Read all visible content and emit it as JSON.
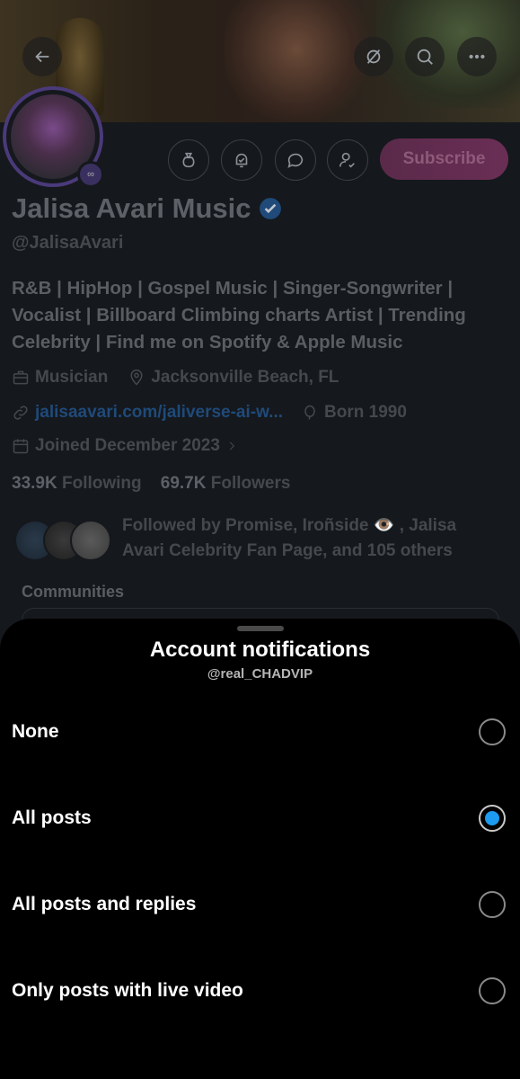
{
  "profile": {
    "name": "Jalisa Avari Music",
    "handle": "@JalisaAvari",
    "bio": "R&B | HipHop | Gospel Music | Singer-Songwriter | Vocalist | Billboard Climbing charts Artist | Trending Celebrity | Find me on Spotify & Apple Music",
    "category": "Musician",
    "location": "Jacksonville Beach, FL",
    "website": "jalisaavari.com/jaliverse-ai-w...",
    "born": "Born 1990",
    "joined": "Joined December 2023",
    "following_count": "33.9K",
    "following_label": "Following",
    "followers_count": "69.7K",
    "followers_label": "Followers",
    "followed_by": "Followed by Promise, Irоñside 👁️ , Jalisa Avari Celebrity Fan Page, and 105 others",
    "subscribe_label": "Subscribe",
    "communities_label": "Communities",
    "avatar_badge": "∞"
  },
  "sheet": {
    "title": "Account notifications",
    "subtitle": "@real_CHADVIP",
    "options": [
      {
        "label": "None",
        "selected": false
      },
      {
        "label": "All posts",
        "selected": true
      },
      {
        "label": "All posts and replies",
        "selected": false
      },
      {
        "label": "Only posts with live video",
        "selected": false
      }
    ]
  },
  "colors": {
    "accent": "#1d9bf0",
    "subscribe_bg": "#6a2e55"
  }
}
